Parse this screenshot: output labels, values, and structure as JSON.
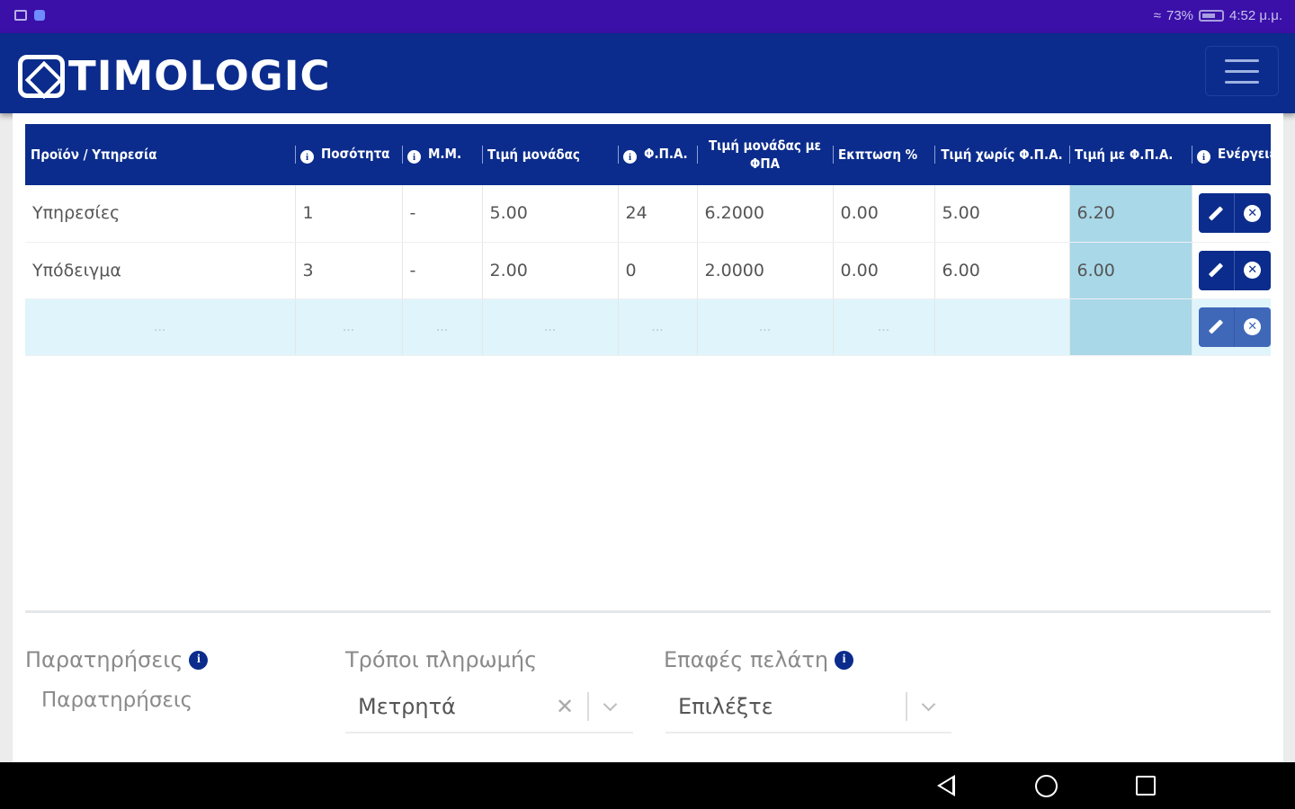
{
  "status_bar": {
    "battery": "73%",
    "time": "4:52 μ.μ."
  },
  "header": {
    "logo_text": "TIMOLOGIC"
  },
  "table": {
    "columns": [
      {
        "label": "Προϊόν / Υπηρεσία"
      },
      {
        "label": "Ποσότητα"
      },
      {
        "label": "Μ.Μ."
      },
      {
        "label": "Τιμή μονάδας"
      },
      {
        "label": "Φ.Π.Α."
      },
      {
        "label": "Τιμή μονάδας με ΦΠΑ"
      },
      {
        "label": "Εκπτωση %"
      },
      {
        "label": "Τιμή χωρίς Φ.Π.Α."
      },
      {
        "label": "Τιμή με Φ.Π.Α."
      },
      {
        "label": "Ενέργειες"
      }
    ],
    "rows": [
      {
        "product": "Υπηρεσίες",
        "quantity": "1",
        "unit": "-",
        "unit_price": "5.00",
        "vat": "24",
        "unit_price_vat": "6.2000",
        "discount": "0.00",
        "net": "5.00",
        "total": "6.20"
      },
      {
        "product": "Υπόδειγμα",
        "quantity": "3",
        "unit": "-",
        "unit_price": "2.00",
        "vat": "0",
        "unit_price_vat": "2.0000",
        "discount": "0.00",
        "net": "6.00",
        "total": "6.00"
      }
    ],
    "new_row_placeholder": "..."
  },
  "footer": {
    "notes_label": "Παρατηρήσεις",
    "notes_placeholder": "Παρατηρήσεις",
    "payment_label": "Τρόποι πληρωμής",
    "payment_value": "Μετρητά",
    "contacts_label": "Επαφές πελάτη",
    "contacts_placeholder": "Επιλέξτε"
  }
}
